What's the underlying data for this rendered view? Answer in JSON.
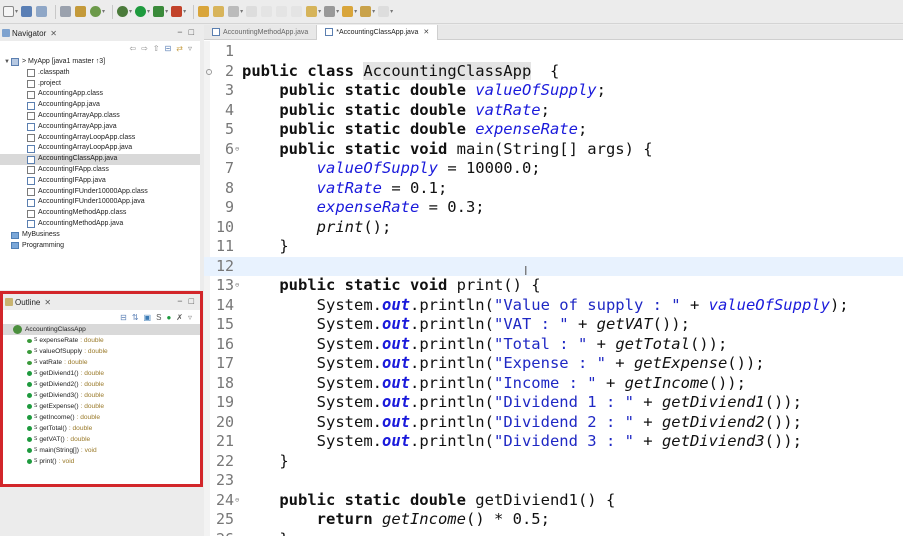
{
  "navigator": {
    "title": "Navigator",
    "items": [
      {
        "label": "> MyApp [java1 master ↑3]",
        "kind": "proj",
        "indent": 0,
        "arrow": "▼"
      },
      {
        "label": ".classpath",
        "kind": "file",
        "indent": 1
      },
      {
        "label": ".project",
        "kind": "file",
        "indent": 1
      },
      {
        "label": "AccountingApp.class",
        "kind": "file",
        "indent": 1
      },
      {
        "label": "AccountingApp.java",
        "kind": "java",
        "indent": 1
      },
      {
        "label": "AccountingArrayApp.class",
        "kind": "file",
        "indent": 1
      },
      {
        "label": "AccountingArrayApp.java",
        "kind": "java",
        "indent": 1
      },
      {
        "label": "AccountingArrayLoopApp.class",
        "kind": "file",
        "indent": 1
      },
      {
        "label": "AccountingArrayLoopApp.java",
        "kind": "java",
        "indent": 1
      },
      {
        "label": "AccountingClassApp.java",
        "kind": "java",
        "indent": 1,
        "selected": true
      },
      {
        "label": "AccountingIFApp.class",
        "kind": "file",
        "indent": 1
      },
      {
        "label": "AccountingIFApp.java",
        "kind": "java",
        "indent": 1
      },
      {
        "label": "AccountingIFUnder10000App.class",
        "kind": "file",
        "indent": 1
      },
      {
        "label": "AccountingIFUnder10000App.java",
        "kind": "java",
        "indent": 1
      },
      {
        "label": "AccountingMethodApp.class",
        "kind": "file",
        "indent": 1
      },
      {
        "label": "AccountingMethodApp.java",
        "kind": "java",
        "indent": 1
      },
      {
        "label": "MyBusiness",
        "kind": "folder",
        "indent": 0
      },
      {
        "label": "Programming",
        "kind": "folder",
        "indent": 0
      }
    ]
  },
  "outline": {
    "title": "Outline",
    "class_name": "AccountingClassApp",
    "members": [
      {
        "name": "expenseRate",
        "type": ": double",
        "kind": "field"
      },
      {
        "name": "valueOfSupply",
        "type": ": double",
        "kind": "field"
      },
      {
        "name": "vatRate",
        "type": ": double",
        "kind": "field"
      },
      {
        "name": "getDiviend1()",
        "type": ": double",
        "kind": "method"
      },
      {
        "name": "getDiviend2()",
        "type": ": double",
        "kind": "method"
      },
      {
        "name": "getDiviend3()",
        "type": ": double",
        "kind": "method"
      },
      {
        "name": "getExpense()",
        "type": ": double",
        "kind": "method"
      },
      {
        "name": "getIncome()",
        "type": ": double",
        "kind": "method"
      },
      {
        "name": "getTotal()",
        "type": ": double",
        "kind": "method"
      },
      {
        "name": "getVAT()",
        "type": ": double",
        "kind": "method"
      },
      {
        "name": "main(String[])",
        "type": ": void",
        "kind": "method"
      },
      {
        "name": "print()",
        "type": ": void",
        "kind": "method"
      }
    ]
  },
  "editor": {
    "tabs": [
      {
        "label": "AccountingMethodApp.java",
        "active": false
      },
      {
        "label": "*AccountingClassApp.java",
        "active": true
      }
    ],
    "current_line": 12,
    "lines": [
      {
        "n": "1",
        "fold": "",
        "parts": []
      },
      {
        "n": "2",
        "fold": "",
        "bp": true,
        "parts": [
          [
            "kw",
            "public class "
          ],
          [
            "hl",
            "AccountingClassApp"
          ],
          [
            "",
            "  {"
          ]
        ]
      },
      {
        "n": "3",
        "fold": "",
        "parts": [
          [
            "",
            "    "
          ],
          [
            "kw",
            "public static double "
          ],
          [
            "fld",
            "valueOfSupply"
          ],
          [
            "",
            ";"
          ]
        ]
      },
      {
        "n": "4",
        "fold": "",
        "parts": [
          [
            "",
            "    "
          ],
          [
            "kw",
            "public static double "
          ],
          [
            "fld",
            "vatRate"
          ],
          [
            "",
            ";"
          ]
        ]
      },
      {
        "n": "5",
        "fold": "",
        "parts": [
          [
            "",
            "    "
          ],
          [
            "kw",
            "public static double "
          ],
          [
            "fld",
            "expenseRate"
          ],
          [
            "",
            ";"
          ]
        ]
      },
      {
        "n": "6",
        "fold": "⊖",
        "parts": [
          [
            "",
            "    "
          ],
          [
            "kw",
            "public static void "
          ],
          [
            "",
            "main(String[] args) {"
          ]
        ]
      },
      {
        "n": "7",
        "fold": "",
        "parts": [
          [
            "",
            "        "
          ],
          [
            "fld",
            "valueOfSupply"
          ],
          [
            "",
            " = 10000.0;"
          ]
        ]
      },
      {
        "n": "8",
        "fold": "",
        "parts": [
          [
            "",
            "        "
          ],
          [
            "fld",
            "vatRate"
          ],
          [
            "",
            " = 0.1;"
          ]
        ]
      },
      {
        "n": "9",
        "fold": "",
        "parts": [
          [
            "",
            "        "
          ],
          [
            "fld",
            "expenseRate"
          ],
          [
            "",
            " = 0.3;"
          ]
        ]
      },
      {
        "n": "10",
        "fold": "",
        "parts": [
          [
            "",
            "        "
          ],
          [
            "call",
            "print"
          ],
          [
            "",
            "();"
          ]
        ]
      },
      {
        "n": "11",
        "fold": "",
        "parts": [
          [
            "",
            "    }"
          ]
        ]
      },
      {
        "n": "12",
        "fold": "",
        "parts": []
      },
      {
        "n": "13",
        "fold": "⊖",
        "parts": [
          [
            "",
            "    "
          ],
          [
            "kw",
            "public static void "
          ],
          [
            "",
            "print() {"
          ]
        ]
      },
      {
        "n": "14",
        "fold": "",
        "parts": [
          [
            "",
            "        System."
          ],
          [
            "sfld",
            "out"
          ],
          [
            "",
            ".println("
          ],
          [
            "str",
            "\"Value of supply : \""
          ],
          [
            "",
            " + "
          ],
          [
            "fld",
            "valueOfSupply"
          ],
          [
            "",
            ");"
          ]
        ]
      },
      {
        "n": "15",
        "fold": "",
        "parts": [
          [
            "",
            "        System."
          ],
          [
            "sfld",
            "out"
          ],
          [
            "",
            ".println("
          ],
          [
            "str",
            "\"VAT : \""
          ],
          [
            "",
            " + "
          ],
          [
            "call",
            "getVAT"
          ],
          [
            "",
            "());"
          ]
        ]
      },
      {
        "n": "16",
        "fold": "",
        "parts": [
          [
            "",
            "        System."
          ],
          [
            "sfld",
            "out"
          ],
          [
            "",
            ".println("
          ],
          [
            "str",
            "\"Total : \""
          ],
          [
            "",
            " + "
          ],
          [
            "call",
            "getTotal"
          ],
          [
            "",
            "());"
          ]
        ]
      },
      {
        "n": "17",
        "fold": "",
        "parts": [
          [
            "",
            "        System."
          ],
          [
            "sfld",
            "out"
          ],
          [
            "",
            ".println("
          ],
          [
            "str",
            "\"Expense : \""
          ],
          [
            "",
            " + "
          ],
          [
            "call",
            "getExpense"
          ],
          [
            "",
            "());"
          ]
        ]
      },
      {
        "n": "18",
        "fold": "",
        "parts": [
          [
            "",
            "        System."
          ],
          [
            "sfld",
            "out"
          ],
          [
            "",
            ".println("
          ],
          [
            "str",
            "\"Income : \""
          ],
          [
            "",
            " + "
          ],
          [
            "call",
            "getIncome"
          ],
          [
            "",
            "());"
          ]
        ]
      },
      {
        "n": "19",
        "fold": "",
        "parts": [
          [
            "",
            "        System."
          ],
          [
            "sfld",
            "out"
          ],
          [
            "",
            ".println("
          ],
          [
            "str",
            "\"Dividend 1 : \""
          ],
          [
            "",
            " + "
          ],
          [
            "call",
            "getDiviend1"
          ],
          [
            "",
            "());"
          ]
        ]
      },
      {
        "n": "20",
        "fold": "",
        "parts": [
          [
            "",
            "        System."
          ],
          [
            "sfld",
            "out"
          ],
          [
            "",
            ".println("
          ],
          [
            "str",
            "\"Dividend 2 : \""
          ],
          [
            "",
            " + "
          ],
          [
            "call",
            "getDiviend2"
          ],
          [
            "",
            "());"
          ]
        ]
      },
      {
        "n": "21",
        "fold": "",
        "parts": [
          [
            "",
            "        System."
          ],
          [
            "sfld",
            "out"
          ],
          [
            "",
            ".println("
          ],
          [
            "str",
            "\"Dividend 3 : \""
          ],
          [
            "",
            " + "
          ],
          [
            "call",
            "getDiviend3"
          ],
          [
            "",
            "());"
          ]
        ]
      },
      {
        "n": "22",
        "fold": "",
        "parts": [
          [
            "",
            "    }"
          ]
        ]
      },
      {
        "n": "23",
        "fold": "",
        "parts": []
      },
      {
        "n": "24",
        "fold": "⊖",
        "parts": [
          [
            "",
            "    "
          ],
          [
            "kw",
            "public static double "
          ],
          [
            "",
            "getDiviend1() {"
          ]
        ]
      },
      {
        "n": "25",
        "fold": "",
        "parts": [
          [
            "",
            "        "
          ],
          [
            "kw",
            "return "
          ],
          [
            "call",
            "getIncome"
          ],
          [
            "",
            "() * 0.5;"
          ]
        ]
      },
      {
        "n": "26",
        "fold": "",
        "parts": [
          [
            "",
            "    }"
          ]
        ]
      }
    ]
  },
  "colors": {
    "outline_highlight": "#d2262a",
    "field_blue": "#1a1adb",
    "current_line": "#e8f2fe"
  }
}
